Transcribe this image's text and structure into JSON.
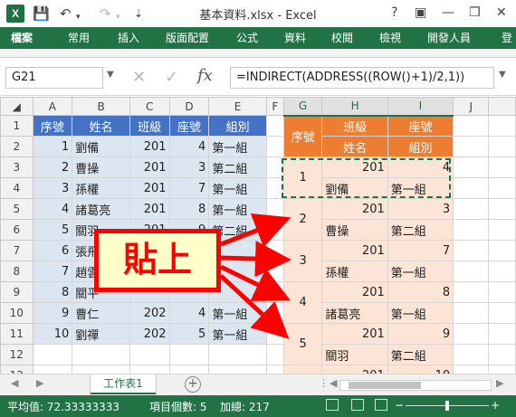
{
  "title_bar": {
    "logo": "X",
    "title": "基本資料.xlsx - Excel",
    "help": "?",
    "controls": [
      "—",
      "❐",
      "✕"
    ]
  },
  "ribbon": {
    "tabs": [
      "檔案",
      "常用",
      "插入",
      "版面配置",
      "公式",
      "資料",
      "校閱",
      "檢視",
      "開發人員",
      "登"
    ]
  },
  "formula_bar": {
    "name_box": "G21",
    "cancel_icon": "✕",
    "enter_icon": "✓",
    "fx_label": "fx",
    "formula": "=INDIRECT(ADDRESS((ROW()+1)/2,1))"
  },
  "grid": {
    "column_letters": [
      "A",
      "B",
      "C",
      "D",
      "E",
      "F",
      "G",
      "H",
      "I",
      "J"
    ],
    "row_numbers": [
      "1",
      "2",
      "3",
      "4",
      "5",
      "6",
      "7",
      "8",
      "9",
      "10",
      "11",
      "12",
      "13"
    ],
    "left_table": {
      "headers": [
        "序號",
        "姓名",
        "班級",
        "座號",
        "組別"
      ],
      "rows": [
        [
          "1",
          "劉備",
          "201",
          "4",
          "第一組"
        ],
        [
          "2",
          "曹操",
          "201",
          "3",
          "第二組"
        ],
        [
          "3",
          "孫權",
          "201",
          "7",
          "第一組"
        ],
        [
          "4",
          "諸葛亮",
          "201",
          "8",
          "第一組"
        ],
        [
          "5",
          "關羽",
          "201",
          "9",
          "第二組"
        ],
        [
          "6",
          "張飛",
          "",
          "",
          ""
        ],
        [
          "7",
          "趙雲",
          "",
          "",
          ""
        ],
        [
          "8",
          "關平",
          "",
          "",
          ""
        ],
        [
          "9",
          "曹仁",
          "202",
          "4",
          "第一組"
        ],
        [
          "10",
          "劉禪",
          "202",
          "5",
          "第一組"
        ]
      ]
    },
    "right_table": {
      "header_g": "序號",
      "header_h_top": "班級",
      "header_h_bottom": "姓名",
      "header_i_top": "座號",
      "header_i_bottom": "組別",
      "records": [
        {
          "seq": "1",
          "class": "201",
          "seat": "4",
          "name": "劉備",
          "group": "第一組"
        },
        {
          "seq": "2",
          "class": "201",
          "seat": "3",
          "name": "曹操",
          "group": "第二組"
        },
        {
          "seq": "3",
          "class": "201",
          "seat": "7",
          "name": "孫權",
          "group": "第一組"
        },
        {
          "seq": "4",
          "class": "201",
          "seat": "8",
          "name": "諸葛亮",
          "group": "第一組"
        },
        {
          "seq": "5",
          "class": "201",
          "seat": "9",
          "name": "關羽",
          "group": "第二組"
        },
        {
          "seq": "",
          "class": "201",
          "seat": "10",
          "name": "",
          "group": ""
        }
      ]
    }
  },
  "overlay": {
    "callout": "貼上",
    "arrow_color": "#ff0000"
  },
  "sheet_tabs": {
    "active": "工作表1",
    "add_icon": "+"
  },
  "status_bar": {
    "average": "平均值: 72.33333333",
    "count": "項目個數: 5",
    "sum": "加總: 217"
  },
  "colors": {
    "excel_green": "#217346",
    "header_blue": "#4472c4",
    "row_blue": "#dce6f1",
    "header_orange": "#ed7d31",
    "row_peach": "#fce4d6"
  }
}
